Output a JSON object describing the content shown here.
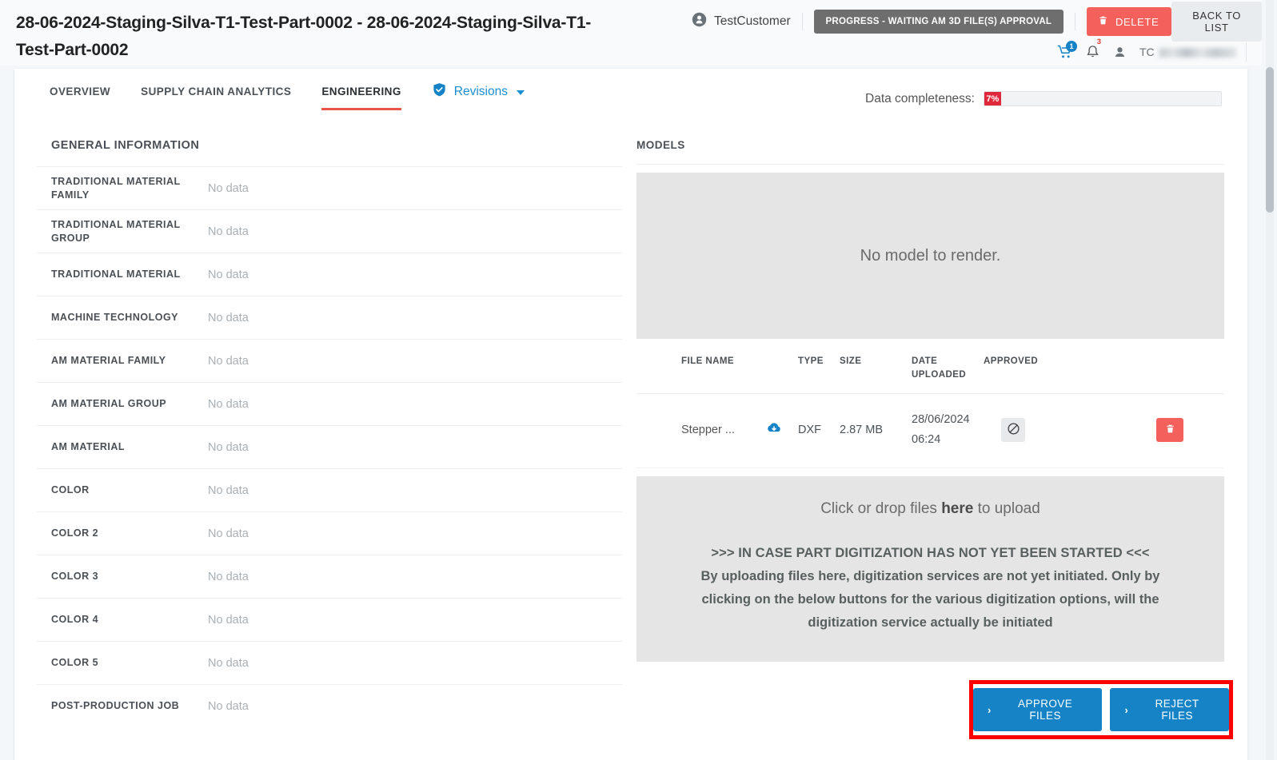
{
  "header": {
    "page_title": "28-06-2024-Staging-Silva-T1-Test-Part-0002 - 28-06-2024-Staging-Silva-T1-Test-Part-0002",
    "customer_name": "TestCustomer",
    "customer_icon": "user-circle-icon",
    "status_badge": "PROGRESS - WAITING AM 3D FILE(S) APPROVAL",
    "delete_label": "DELETE",
    "delete_icon": "trash-icon",
    "back_to_list_label": "BACK TO LIST",
    "cart_icon": "shopping-cart-icon",
    "cart_count": "1",
    "bell_icon": "bell-icon",
    "bell_count": "3",
    "user_icon": "user-avatar-icon",
    "user_initials": "TC",
    "user_name_redacted": ""
  },
  "tabs": [
    {
      "label": "OVERVIEW",
      "active": false
    },
    {
      "label": "SUPPLY CHAIN ANALYTICS",
      "active": false
    },
    {
      "label": "ENGINEERING",
      "active": true
    }
  ],
  "revisions": {
    "label": "Revisions",
    "shield_icon": "shield-check-icon",
    "caret_icon": "chevron-down-icon"
  },
  "completeness": {
    "label": "Data completeness:",
    "value": "7%",
    "percent": 7,
    "fill_color": "#e0283c"
  },
  "general_information": {
    "section_title": "GENERAL INFORMATION",
    "rows": [
      {
        "label": "TRADITIONAL MATERIAL FAMILY",
        "value": "No data"
      },
      {
        "label": "TRADITIONAL MATERIAL GROUP",
        "value": "No data"
      },
      {
        "label": "TRADITIONAL MATERIAL",
        "value": "No data"
      },
      {
        "label": "MACHINE TECHNOLOGY",
        "value": "No data"
      },
      {
        "label": "AM MATERIAL FAMILY",
        "value": "No data"
      },
      {
        "label": "AM MATERIAL GROUP",
        "value": "No data"
      },
      {
        "label": "AM MATERIAL",
        "value": "No data"
      },
      {
        "label": "COLOR",
        "value": "No data"
      },
      {
        "label": "COLOR 2",
        "value": "No data"
      },
      {
        "label": "COLOR 3",
        "value": "No data"
      },
      {
        "label": "COLOR 4",
        "value": "No data"
      },
      {
        "label": "COLOR 5",
        "value": "No data"
      },
      {
        "label": "POST-PRODUCTION JOB",
        "value": "No data"
      }
    ]
  },
  "models": {
    "section_title": "MODELS",
    "viewer_empty_text": "No model to render.",
    "table_headers": {
      "file_name": "FILE NAME",
      "type": "TYPE",
      "size": "SIZE",
      "date_uploaded": "DATE UPLOADED",
      "approved": "APPROVED"
    },
    "files": [
      {
        "name": "Stepper ...",
        "download_icon": "download-cloud-icon",
        "type": "DXF",
        "size": "2.87 MB",
        "date_uploaded": "28/06/2024 06:24",
        "approved_icon": "prohibited-circle-slash-icon",
        "delete_icon": "trash-icon"
      }
    ]
  },
  "drop_zone": {
    "main_text_before": "Click or drop files ",
    "main_text_bold": "here",
    "main_text_after": " to upload",
    "warning_heading": ">>> IN CASE PART DIGITIZATION HAS NOT YET BEEN STARTED <<<",
    "warning_line_1": "By uploading files here, digitization services are not yet initiated. Only by",
    "warning_line_2": "clicking on the below buttons for the various digitization options, will the",
    "warning_line_3": "digitization service actually be initiated"
  },
  "actions": {
    "approve_label": "APPROVE FILES",
    "reject_label": "REJECT FILES",
    "chevron": "›",
    "highlight_color": "#ff0000",
    "button_color": "#1583c6"
  }
}
